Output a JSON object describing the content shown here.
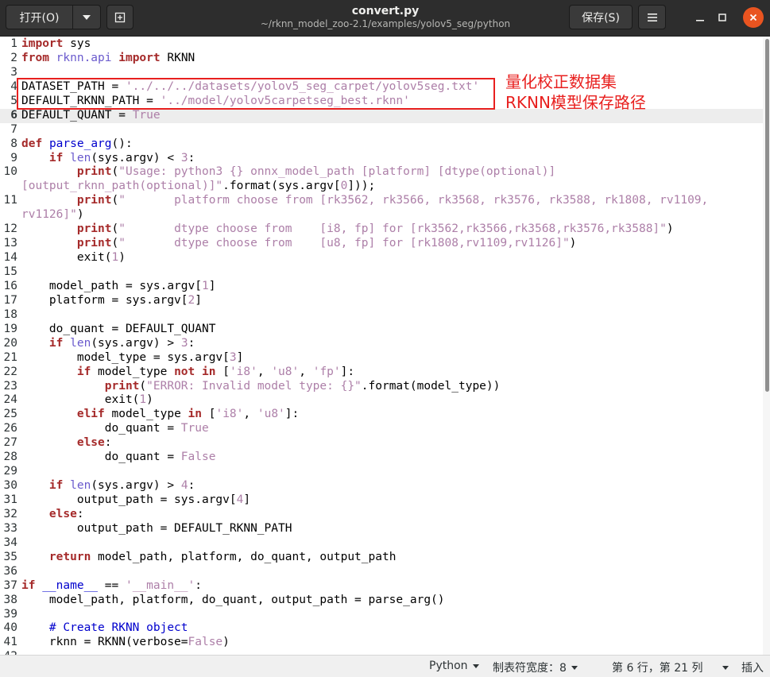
{
  "header": {
    "open_label": "打开(O)",
    "title": "convert.py",
    "subtitle": "~/rknn_model_zoo-2.1/examples/yolov5_seg/python",
    "save_label": "保存(S)",
    "close_color": "#e95420"
  },
  "editor": {
    "current_line": 6,
    "lines": [
      {
        "n": "1",
        "t": [
          [
            "kw",
            "import"
          ],
          [
            "",
            " sys"
          ]
        ]
      },
      {
        "n": "2",
        "t": [
          [
            "kw",
            "from"
          ],
          [
            "",
            " "
          ],
          [
            "im",
            "rknn.api"
          ],
          [
            "",
            " "
          ],
          [
            "kw",
            "import"
          ],
          [
            "",
            " RKNN"
          ]
        ]
      },
      {
        "n": "3",
        "t": []
      },
      {
        "n": "4",
        "t": [
          [
            "",
            "DATASET_PATH = "
          ],
          [
            "st",
            "'../../../datasets/yolov5_seg_carpet/yolov5seg.txt'"
          ]
        ]
      },
      {
        "n": "5",
        "t": [
          [
            "",
            "DEFAULT_RKNN_PATH = "
          ],
          [
            "st",
            "'../model/yolov5carpetseg_best.rknn'"
          ]
        ]
      },
      {
        "n": "6",
        "t": [
          [
            "",
            "DEFAULT_QUANT = "
          ],
          [
            "bl",
            "True"
          ]
        ]
      },
      {
        "n": "7",
        "t": []
      },
      {
        "n": "8",
        "t": [
          [
            "kw",
            "def"
          ],
          [
            "",
            " "
          ],
          [
            "fn",
            "parse_arg"
          ],
          [
            "",
            "():"
          ]
        ]
      },
      {
        "n": "9",
        "t": [
          [
            "",
            "    "
          ],
          [
            "kw",
            "if"
          ],
          [
            "",
            " "
          ],
          [
            "bi",
            "len"
          ],
          [
            "",
            "(sys.argv) < "
          ],
          [
            "nm",
            "3"
          ],
          [
            "",
            ":"
          ]
        ]
      },
      {
        "n": "10",
        "t": [
          [
            "",
            "        "
          ],
          [
            "kw",
            "print"
          ],
          [
            "",
            "("
          ],
          [
            "st",
            "\"Usage: python3 {} onnx_model_path [platform] [dtype(optional)]"
          ]
        ]
      },
      {
        "n": "",
        "t": [
          [
            "st",
            "[output_rknn_path(optional)]\""
          ],
          [
            "",
            ".format(sys.argv["
          ],
          [
            "nm",
            "0"
          ],
          [
            "",
            "]));"
          ]
        ]
      },
      {
        "n": "11",
        "t": [
          [
            "",
            "        "
          ],
          [
            "kw",
            "print"
          ],
          [
            "",
            "("
          ],
          [
            "st",
            "\"       platform choose from [rk3562, rk3566, rk3568, rk3576, rk3588, rk1808, rv1109,"
          ]
        ]
      },
      {
        "n": "",
        "t": [
          [
            "st",
            "rv1126]\""
          ],
          [
            "",
            ")"
          ]
        ]
      },
      {
        "n": "12",
        "t": [
          [
            "",
            "        "
          ],
          [
            "kw",
            "print"
          ],
          [
            "",
            "("
          ],
          [
            "st",
            "\"       dtype choose from    [i8, fp] for [rk3562,rk3566,rk3568,rk3576,rk3588]\""
          ],
          [
            "",
            ")"
          ]
        ]
      },
      {
        "n": "13",
        "t": [
          [
            "",
            "        "
          ],
          [
            "kw",
            "print"
          ],
          [
            "",
            "("
          ],
          [
            "st",
            "\"       dtype choose from    [u8, fp] for [rk1808,rv1109,rv1126]\""
          ],
          [
            "",
            ")"
          ]
        ]
      },
      {
        "n": "14",
        "t": [
          [
            "",
            "        exit("
          ],
          [
            "nm",
            "1"
          ],
          [
            "",
            ")"
          ]
        ]
      },
      {
        "n": "15",
        "t": []
      },
      {
        "n": "16",
        "t": [
          [
            "",
            "    model_path = sys.argv["
          ],
          [
            "nm",
            "1"
          ],
          [
            "",
            "]"
          ]
        ]
      },
      {
        "n": "17",
        "t": [
          [
            "",
            "    platform = sys.argv["
          ],
          [
            "nm",
            "2"
          ],
          [
            "",
            "]"
          ]
        ]
      },
      {
        "n": "18",
        "t": []
      },
      {
        "n": "19",
        "t": [
          [
            "",
            "    do_quant = DEFAULT_QUANT"
          ]
        ]
      },
      {
        "n": "20",
        "t": [
          [
            "",
            "    "
          ],
          [
            "kw",
            "if"
          ],
          [
            "",
            " "
          ],
          [
            "bi",
            "len"
          ],
          [
            "",
            "(sys.argv) > "
          ],
          [
            "nm",
            "3"
          ],
          [
            "",
            ":"
          ]
        ]
      },
      {
        "n": "21",
        "t": [
          [
            "",
            "        model_type = sys.argv["
          ],
          [
            "nm",
            "3"
          ],
          [
            "",
            "]"
          ]
        ]
      },
      {
        "n": "22",
        "t": [
          [
            "",
            "        "
          ],
          [
            "kw",
            "if"
          ],
          [
            "",
            " model_type "
          ],
          [
            "kw",
            "not in"
          ],
          [
            "",
            " ["
          ],
          [
            "st",
            "'i8'"
          ],
          [
            "",
            ", "
          ],
          [
            "st",
            "'u8'"
          ],
          [
            "",
            ", "
          ],
          [
            "st",
            "'fp'"
          ],
          [
            "",
            "]:"
          ]
        ]
      },
      {
        "n": "23",
        "t": [
          [
            "",
            "            "
          ],
          [
            "kw",
            "print"
          ],
          [
            "",
            "("
          ],
          [
            "st",
            "\"ERROR: Invalid model type: {}\""
          ],
          [
            "",
            ".format(model_type))"
          ]
        ]
      },
      {
        "n": "24",
        "t": [
          [
            "",
            "            exit("
          ],
          [
            "nm",
            "1"
          ],
          [
            "",
            ")"
          ]
        ]
      },
      {
        "n": "25",
        "t": [
          [
            "",
            "        "
          ],
          [
            "kw",
            "elif"
          ],
          [
            "",
            " model_type "
          ],
          [
            "kw",
            "in"
          ],
          [
            "",
            " ["
          ],
          [
            "st",
            "'i8'"
          ],
          [
            "",
            ", "
          ],
          [
            "st",
            "'u8'"
          ],
          [
            "",
            "]:"
          ]
        ]
      },
      {
        "n": "26",
        "t": [
          [
            "",
            "            do_quant = "
          ],
          [
            "bl",
            "True"
          ]
        ]
      },
      {
        "n": "27",
        "t": [
          [
            "",
            "        "
          ],
          [
            "kw",
            "else"
          ],
          [
            "",
            ":"
          ]
        ]
      },
      {
        "n": "28",
        "t": [
          [
            "",
            "            do_quant = "
          ],
          [
            "bl",
            "False"
          ]
        ]
      },
      {
        "n": "29",
        "t": []
      },
      {
        "n": "30",
        "t": [
          [
            "",
            "    "
          ],
          [
            "kw",
            "if"
          ],
          [
            "",
            " "
          ],
          [
            "bi",
            "len"
          ],
          [
            "",
            "(sys.argv) > "
          ],
          [
            "nm",
            "4"
          ],
          [
            "",
            ":"
          ]
        ]
      },
      {
        "n": "31",
        "t": [
          [
            "",
            "        output_path = sys.argv["
          ],
          [
            "nm",
            "4"
          ],
          [
            "",
            "]"
          ]
        ]
      },
      {
        "n": "32",
        "t": [
          [
            "",
            "    "
          ],
          [
            "kw",
            "else"
          ],
          [
            "",
            ":"
          ]
        ]
      },
      {
        "n": "33",
        "t": [
          [
            "",
            "        output_path = DEFAULT_RKNN_PATH"
          ]
        ]
      },
      {
        "n": "34",
        "t": []
      },
      {
        "n": "35",
        "t": [
          [
            "",
            "    "
          ],
          [
            "kw",
            "return"
          ],
          [
            "",
            " model_path, platform, do_quant, output_path"
          ]
        ]
      },
      {
        "n": "36",
        "t": []
      },
      {
        "n": "37",
        "t": [
          [
            "kw",
            "if"
          ],
          [
            "",
            " "
          ],
          [
            "fn",
            "__name__"
          ],
          [
            "",
            " == "
          ],
          [
            "st",
            "'__main__'"
          ],
          [
            "",
            ":"
          ]
        ]
      },
      {
        "n": "38",
        "t": [
          [
            "",
            "    model_path, platform, do_quant, output_path = parse_arg()"
          ]
        ]
      },
      {
        "n": "39",
        "t": []
      },
      {
        "n": "40",
        "t": [
          [
            "",
            "    "
          ],
          [
            "cm",
            "# Create RKNN object"
          ]
        ]
      },
      {
        "n": "41",
        "t": [
          [
            "",
            "    rknn = RKNN(verbose="
          ],
          [
            "bl",
            "False"
          ],
          [
            "",
            ")"
          ]
        ]
      },
      {
        "n": "42",
        "t": []
      }
    ]
  },
  "annotation": {
    "line1": "量化校正数据集",
    "line2": "RKNN模型保存路径",
    "color": "#e8201f"
  },
  "statusbar": {
    "language": "Python",
    "tab_width": "制表符宽度：8",
    "position": "第 6 行，第 21 列",
    "mode": "插入"
  }
}
